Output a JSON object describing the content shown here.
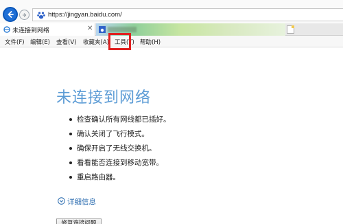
{
  "browser": {
    "url": "https://jingyan.baidu.com/",
    "tabs": [
      {
        "label": "未连接到网络",
        "active": true
      },
      {
        "label": "",
        "active": false
      }
    ]
  },
  "menubar": {
    "items": [
      "文件(F)",
      "编辑(E)",
      "查看(V)",
      "收藏夹(A)",
      "工具(T)",
      "帮助(H)"
    ],
    "highlighted": "工具(T)",
    "highlight_color": "#e02020"
  },
  "page": {
    "title": "未连接到网络",
    "title_color": "#5b9bd5",
    "tips": [
      "检查确认所有网线都已插好。",
      "确认关闭了飞行模式。",
      "确保开启了无线交换机。",
      "看看能否连接到移动宽带。",
      "重启路由器。"
    ],
    "details_label": "详细信息",
    "fix_button_label": "修复连接问题"
  }
}
